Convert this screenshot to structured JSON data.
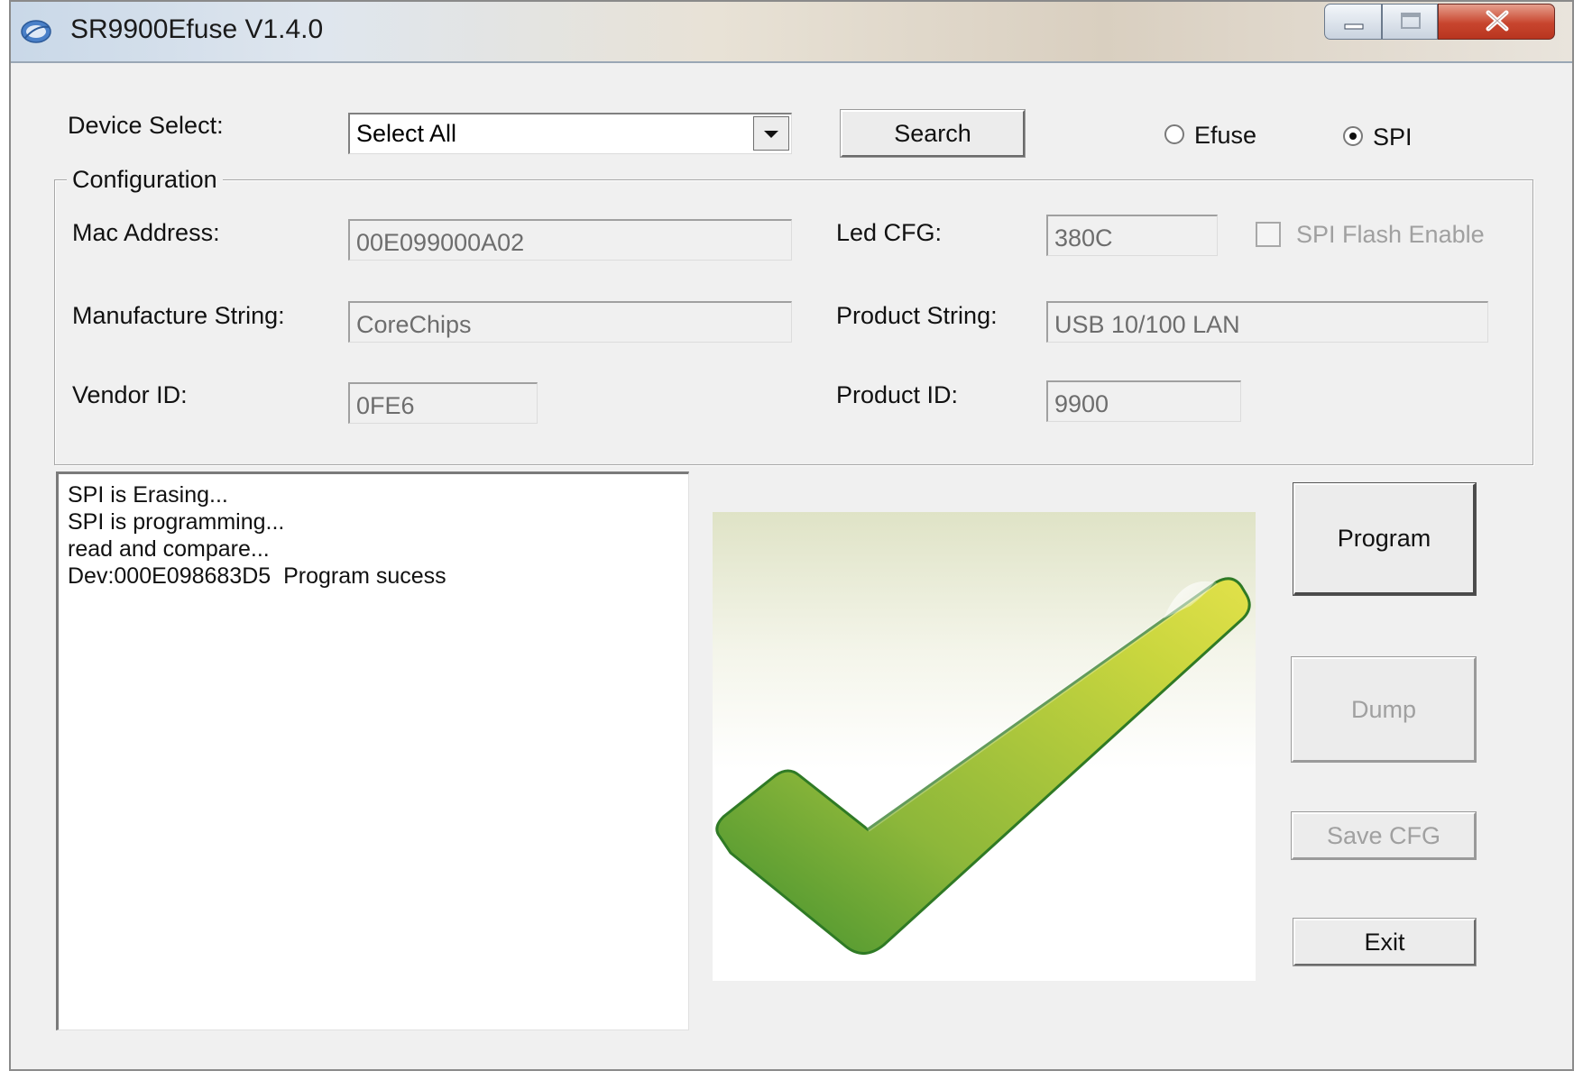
{
  "window": {
    "title": "SR9900Efuse V1.4.0"
  },
  "device": {
    "label": "Device Select:",
    "selected": "Select All",
    "search_label": "Search"
  },
  "mode": {
    "efuse_label": "Efuse",
    "spi_label": "SPI",
    "selected": "SPI"
  },
  "configuration": {
    "title": "Configuration",
    "mac_label": "Mac Address:",
    "mac_value": "00E099000A02",
    "led_label": "Led CFG:",
    "led_value": "380C",
    "spi_flash_label": "SPI Flash Enable",
    "spi_flash_checked": false,
    "manufacture_label": "Manufacture String:",
    "manufacture_value": "CoreChips",
    "product_string_label": "Product String:",
    "product_string_value": "USB 10/100 LAN",
    "vendor_label": "Vendor ID:",
    "vendor_value": "0FE6",
    "product_id_label": "Product ID:",
    "product_id_value": "9900"
  },
  "log": {
    "lines": [
      "SPI is Erasing...",
      "SPI is programming...",
      "read and compare...",
      "Dev:000E098683D5  Program sucess"
    ]
  },
  "actions": {
    "program_label": "Program",
    "dump_label": "Dump",
    "save_cfg_label": "Save CFG",
    "exit_label": "Exit"
  },
  "icons": {
    "app": "app-logo-icon",
    "dropdown": "chevron-down-icon",
    "status": "checkmark-icon",
    "minimize": "minimize-icon",
    "maximize": "maximize-icon",
    "close": "close-icon"
  },
  "colors": {
    "checkmark_light": "#e2e14a",
    "checkmark_dark": "#3f8f2e",
    "close_button": "#c8452e"
  }
}
